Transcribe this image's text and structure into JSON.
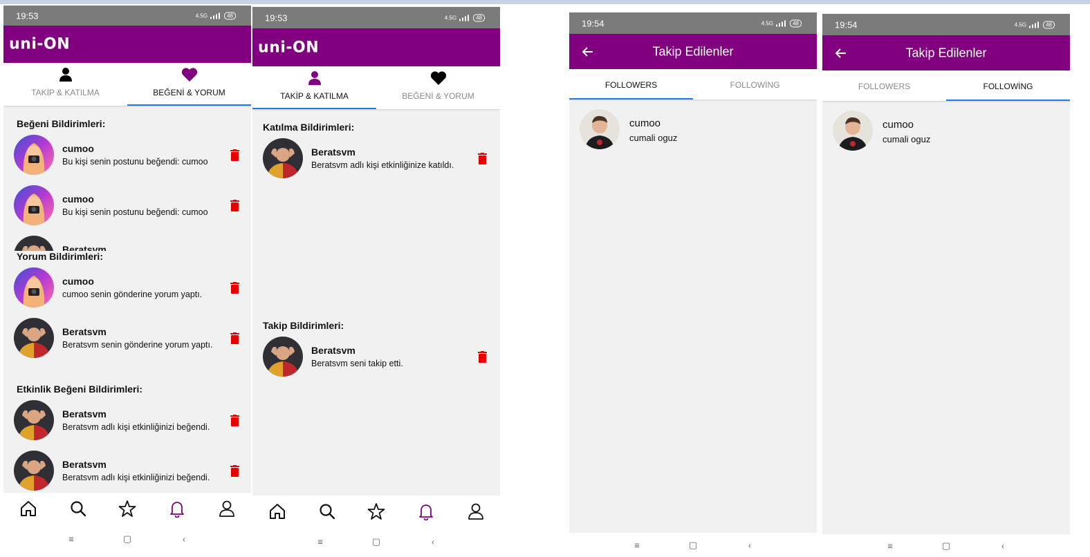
{
  "status": {
    "time1": "19:53",
    "time2": "19:53",
    "time3": "19:54",
    "time4": "19:54",
    "net": "4.5G",
    "battery": "48"
  },
  "app": {
    "logo": "uni-ON"
  },
  "tabs": {
    "follow_join": "TAKİP & KATILMA",
    "like_comment": "BEĞENİ & YORUM"
  },
  "screen1": {
    "like_title": "Beğeni Bildirimleri:",
    "like_items": [
      {
        "name": "cumoo",
        "msg": "Bu kişi senin postunu beğendi: cumoo"
      },
      {
        "name": "cumoo",
        "msg": "Bu kişi senin postunu beğendi: cumoo"
      }
    ],
    "partial_name": "Beratsvm",
    "comment_title": "Yorum Bildirimleri:",
    "comment_items": [
      {
        "name": "cumoo",
        "msg": "cumoo senin gönderine yorum yaptı."
      },
      {
        "name": "Beratsvm",
        "msg": "Beratsvm senin gönderine yorum yaptı."
      }
    ],
    "event_title": "Etkinlik Beğeni Bildirimleri:",
    "event_items": [
      {
        "name": "Beratsvm",
        "msg": "Beratsvm adlı kişi etkinliğinizi beğendi."
      },
      {
        "name": "Beratsvm",
        "msg": "Beratsvm adlı kişi etkinliğinizi beğendi."
      }
    ]
  },
  "screen2": {
    "join_title": "Katılma Bildirimleri:",
    "join_item": {
      "name": "Beratsvm",
      "msg": "Beratsvm adlı kişi etkinliğinize katıldı."
    },
    "follow_title": "Takip Bildirimleri:",
    "follow_item": {
      "name": "Beratsvm",
      "msg": "Beratsvm seni takip etti."
    }
  },
  "followers_screen": {
    "title": "Takip Edilenler",
    "tab_followers": "FOLLOWERS",
    "tab_following": "FOLLOWİNG",
    "user": {
      "name": "cumoo",
      "fullname": "cumali oguz"
    }
  },
  "sysnav": {
    "menu": "≡",
    "home": "▢",
    "back": "‹"
  },
  "colors": {
    "brand": "#800080",
    "accent": "#1e7be2",
    "delete": "#e60000"
  }
}
